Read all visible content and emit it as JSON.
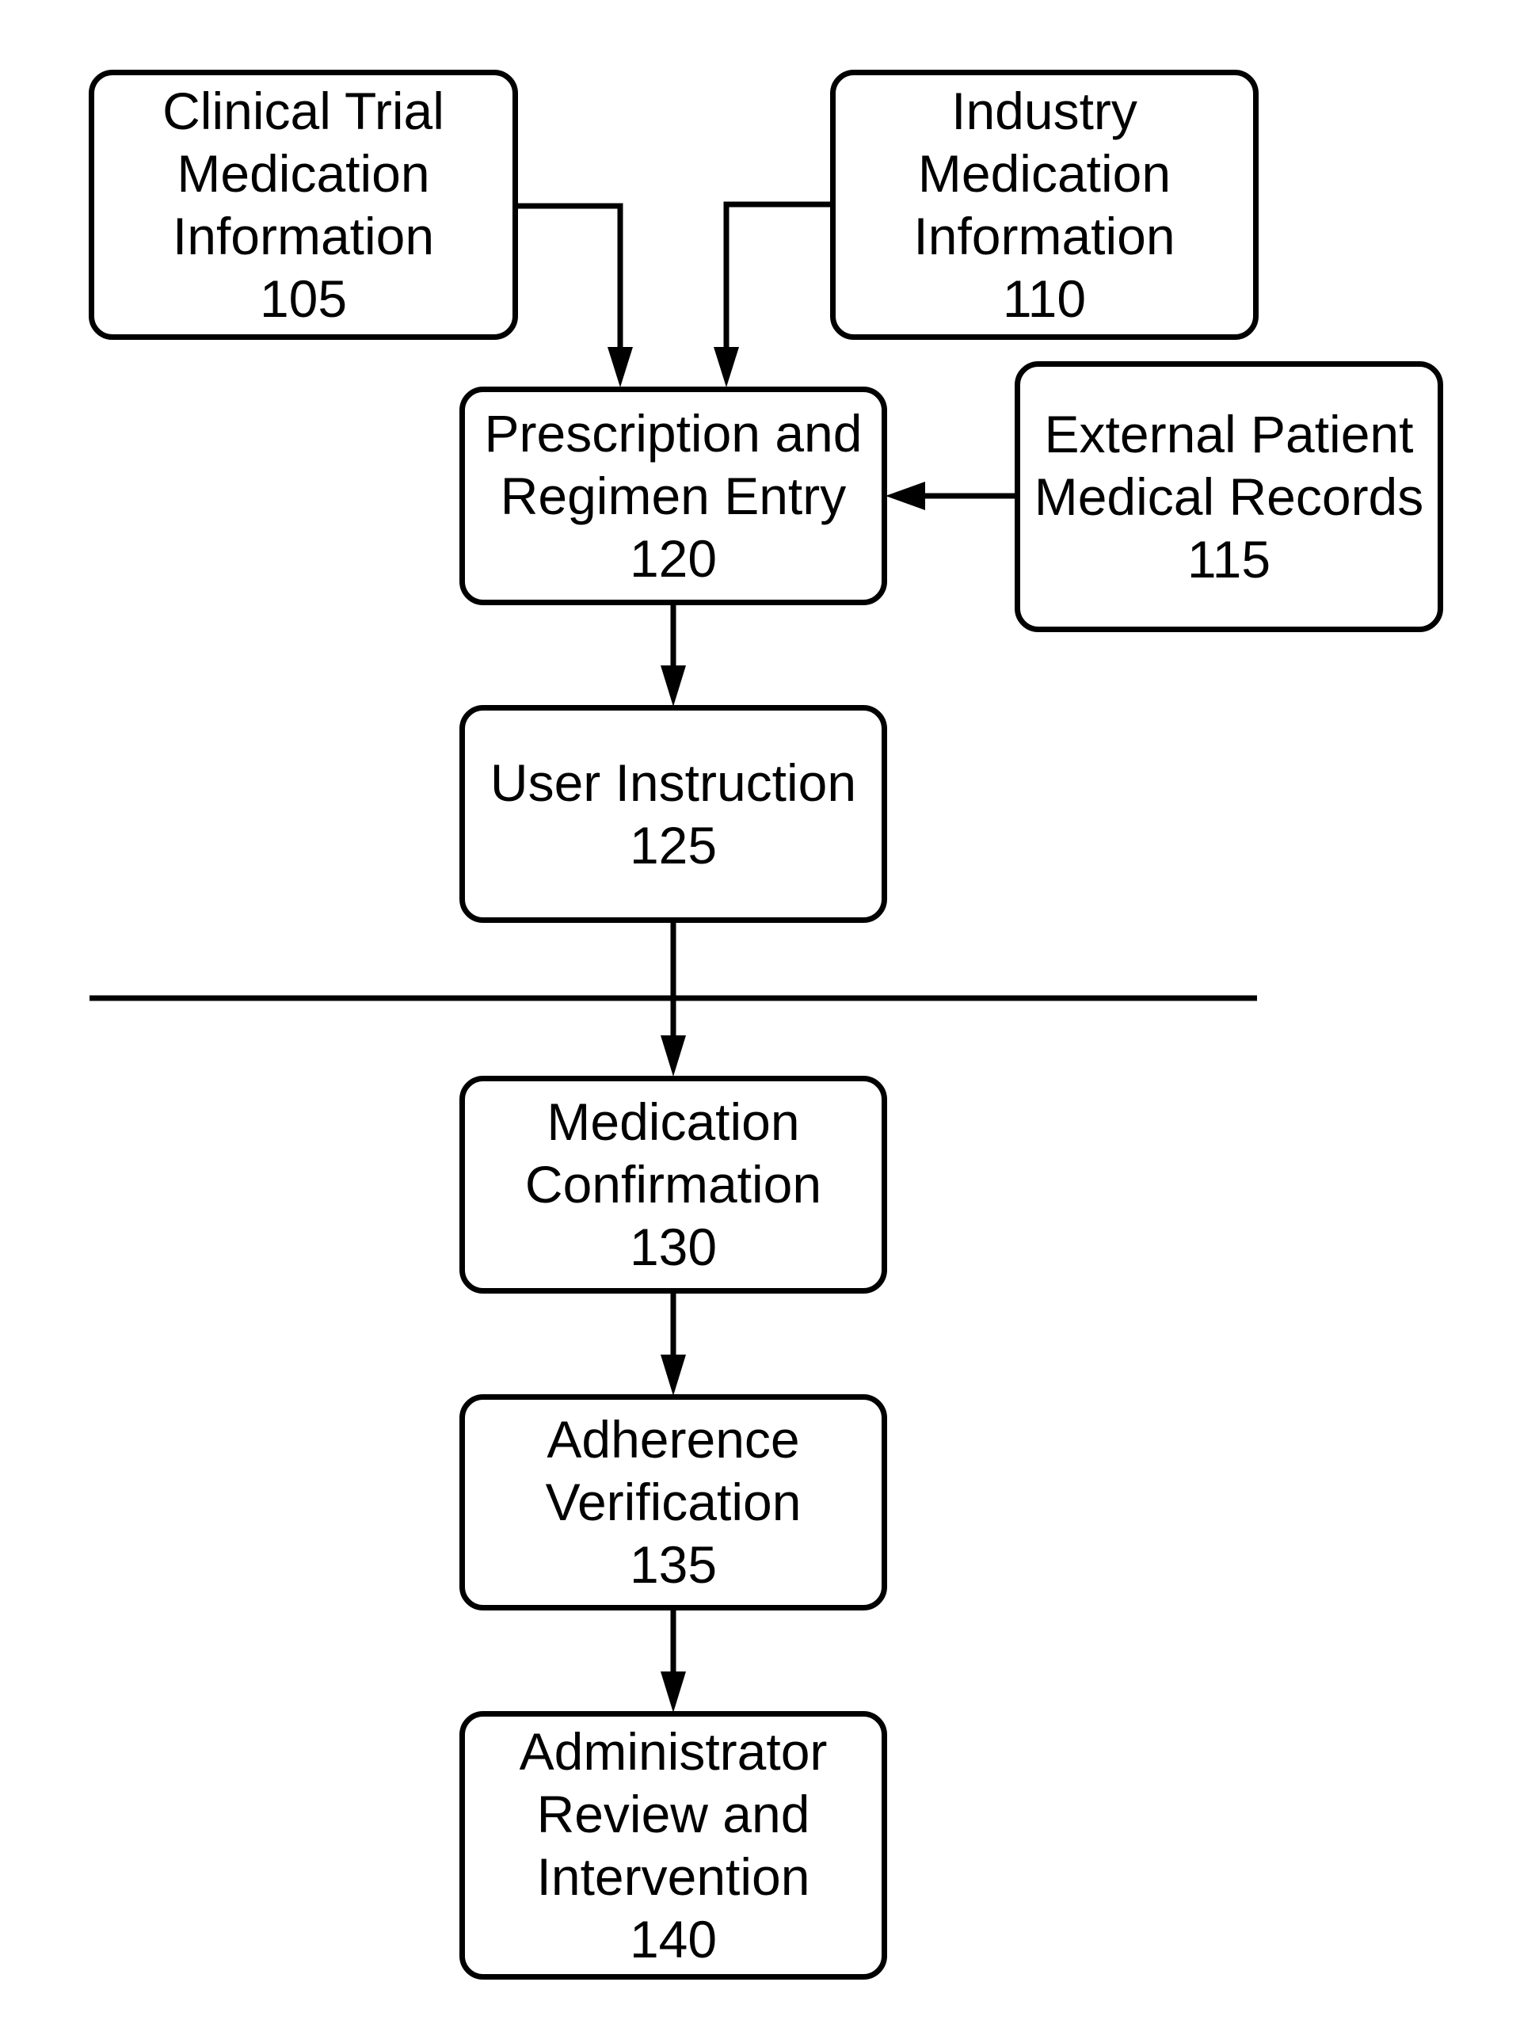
{
  "diagram": {
    "type": "flowchart",
    "colors": {
      "stroke": "#000000",
      "background": "#ffffff",
      "text": "#000000"
    },
    "nodes": [
      {
        "id": "105",
        "lines": [
          "Clinical Trial",
          "Medication",
          "Information",
          "105"
        ]
      },
      {
        "id": "110",
        "lines": [
          "Industry",
          "Medication",
          "Information",
          "110"
        ]
      },
      {
        "id": "115",
        "lines": [
          "External Patient",
          "Medical Records",
          "115"
        ]
      },
      {
        "id": "120",
        "lines": [
          "Prescription and",
          "Regimen Entry",
          "120"
        ]
      },
      {
        "id": "125",
        "lines": [
          "User Instruction",
          "125"
        ]
      },
      {
        "id": "130",
        "lines": [
          "Medication",
          "Confirmation",
          "130"
        ]
      },
      {
        "id": "135",
        "lines": [
          "Adherence",
          "Verification",
          "135"
        ]
      },
      {
        "id": "140",
        "lines": [
          "Administrator",
          "Review and",
          "Intervention",
          "140"
        ]
      }
    ],
    "edges": [
      {
        "from": "105",
        "to": "120"
      },
      {
        "from": "110",
        "to": "120"
      },
      {
        "from": "115",
        "to": "120"
      },
      {
        "from": "120",
        "to": "125"
      },
      {
        "from": "125",
        "to": "130"
      },
      {
        "from": "130",
        "to": "135"
      },
      {
        "from": "135",
        "to": "140"
      }
    ],
    "separator": "horizontal divider between User Instruction 125 and Medication Confirmation 130"
  }
}
